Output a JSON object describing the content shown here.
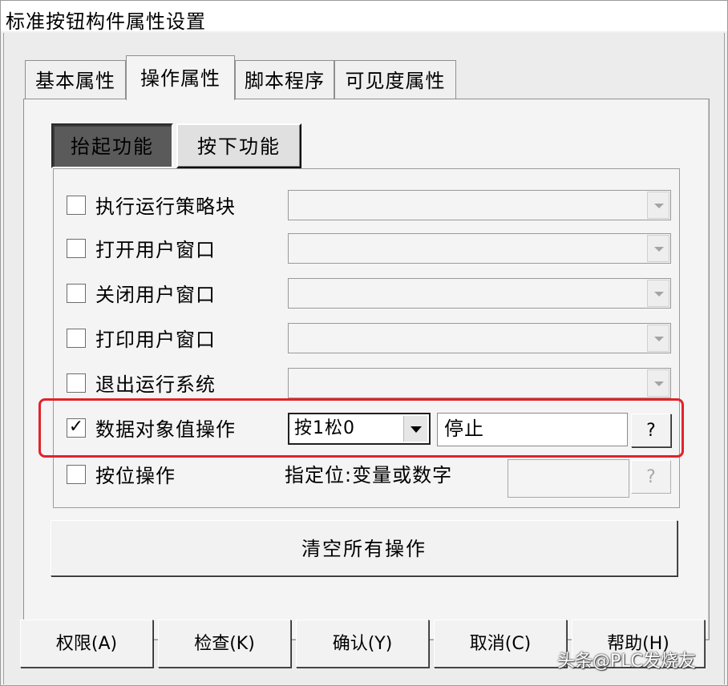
{
  "window": {
    "title": "标准按钮构件属性设置"
  },
  "tabs": [
    {
      "label": "基本属性",
      "active": false
    },
    {
      "label": "操作属性",
      "active": true
    },
    {
      "label": "脚本程序",
      "active": false
    },
    {
      "label": "可见度属性",
      "active": false
    }
  ],
  "subtabs": [
    {
      "label": "抬起功能",
      "selected": true
    },
    {
      "label": "按下功能",
      "selected": false
    }
  ],
  "actions": [
    {
      "label": "执行运行策略块",
      "checked": false,
      "check_mark": ""
    },
    {
      "label": "打开用户窗口",
      "checked": false,
      "check_mark": ""
    },
    {
      "label": "关闭用户窗口",
      "checked": false,
      "check_mark": ""
    },
    {
      "label": "打印用户窗口",
      "checked": false,
      "check_mark": ""
    },
    {
      "label": "退出运行系统",
      "checked": false,
      "check_mark": ""
    }
  ],
  "data_object": {
    "label": "数据对象值操作",
    "checked": true,
    "check_mark": "✓",
    "mode_value": "按1松0",
    "variable_value": "停止",
    "browse_label": "?"
  },
  "bit_op": {
    "label": "按位操作",
    "checked": false,
    "check_mark": "",
    "hint": "指定位:变量或数字",
    "browse_label": "?"
  },
  "clear_button": {
    "label": "清空所有操作"
  },
  "bottom_buttons": {
    "permission": "权限(A)",
    "check": "检查(K)",
    "confirm": "确认(Y)",
    "cancel": "取消(C)",
    "help": "帮助(H)"
  },
  "watermark": "头条@PLC发烧友",
  "colors": {
    "highlight": "#e0232a",
    "pressed_tab": "#5a5a5a"
  }
}
